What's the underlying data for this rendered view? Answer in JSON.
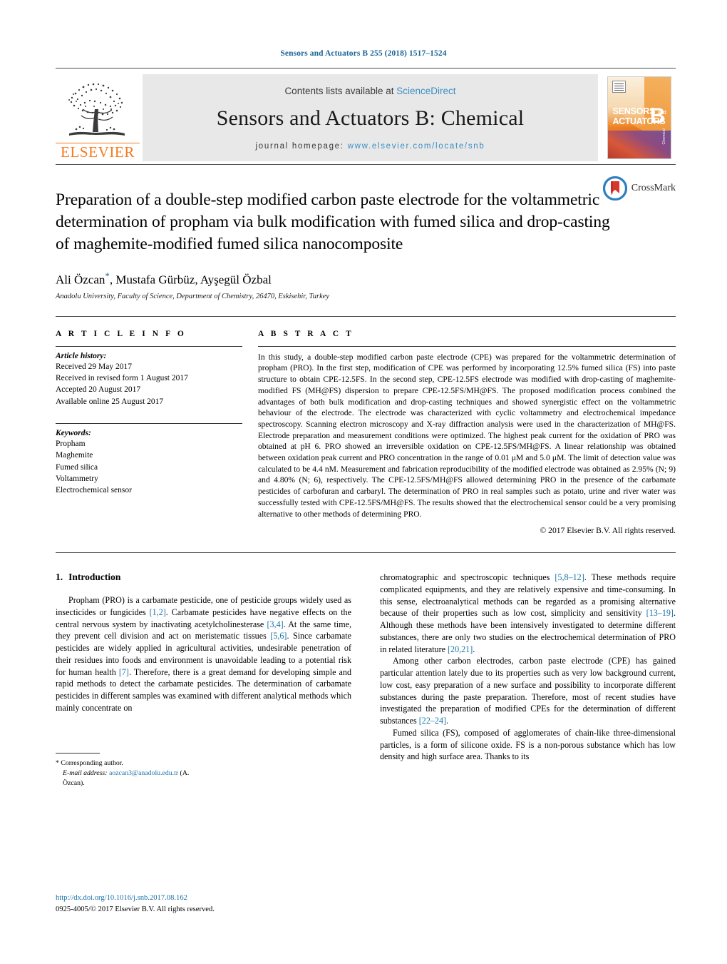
{
  "running_head": "Sensors and Actuators B 255 (2018) 1517–1524",
  "masthead": {
    "contents_prefix": "Contents lists available at ",
    "contents_link": "ScienceDirect",
    "journal_title": "Sensors and Actuators B: Chemical",
    "homepage_prefix": "journal homepage: ",
    "homepage_link": "www.elsevier.com/locate/snb",
    "publisher": "ELSEVIER",
    "cover": {
      "line1": "SENSORS",
      "line1_small": "and",
      "line2": "ACTUATORS",
      "letter": "B",
      "letter_sub": "Chemical"
    },
    "colors": {
      "link": "#3a8fc4",
      "elsevier_orange": "#f47b20",
      "panel_gray": "#e8e8e8"
    }
  },
  "article": {
    "title": "Preparation of a double-step modified carbon paste electrode for the voltammetric determination of propham via bulk modification with fumed silica and drop-casting of maghemite-modified fumed silica nanocomposite",
    "authors": "Ali Özcan",
    "authors_rest": ", Mustafa Gürbüz, Ayşegül Özbal",
    "corresponding_marker": "*",
    "affiliation": "Anadolu University, Faculty of Science, Department of Chemistry, 26470, Eskisehir, Turkey",
    "crossmark_label": "CrossMark"
  },
  "article_info": {
    "heading": "A R T I C L E   I N F O",
    "history_label": "Article history:",
    "history": [
      "Received 29 May 2017",
      "Received in revised form 1 August 2017",
      "Accepted 20 August 2017",
      "Available online 25 August 2017"
    ],
    "keywords_label": "Keywords:",
    "keywords": [
      "Propham",
      "Maghemite",
      "Fumed silica",
      "Voltammetry",
      "Electrochemical sensor"
    ]
  },
  "abstract": {
    "heading": "A B S T R A C T",
    "text": "In this study, a double-step modified carbon paste electrode (CPE) was prepared for the voltammetric determination of propham (PRO). In the first step, modification of CPE was performed by incorporating 12.5% fumed silica (FS) into paste structure to obtain CPE-12.5FS. In the second step, CPE-12.5FS electrode was modified with drop-casting of maghemite-modified FS (MH@FS) dispersion to prepare CPE-12.5FS/MH@FS. The proposed modification process combined the advantages of both bulk modification and drop-casting techniques and showed synergistic effect on the voltammetric behaviour of the electrode. The electrode was characterized with cyclic voltammetry and electrochemical impedance spectroscopy. Scanning electron microscopy and X-ray diffraction analysis were used in the characterization of MH@FS. Electrode preparation and measurement conditions were optimized. The highest peak current for the oxidation of PRO was obtained at pH 6. PRO showed an irreversible oxidation on CPE-12.5FS/MH@FS. A linear relationship was obtained between oxidation peak current and PRO concentration in the range of 0.01 μM and 5.0 μM. The limit of detection value was calculated to be 4.4 nM. Measurement and fabrication reproducibility of the modified electrode was obtained as 2.95% (N; 9) and 4.80% (N; 6), respectively. The CPE-12.5FS/MH@FS allowed determining PRO in the presence of the carbamate pesticides of carbofuran and carbaryl. The determination of PRO in real samples such as potato, urine and river water was successfully tested with CPE-12.5FS/MH@FS. The results showed that the electrochemical sensor could be a very promising alternative to other methods of determining PRO.",
    "copyright": "© 2017 Elsevier B.V. All rights reserved."
  },
  "introduction": {
    "number": "1.",
    "heading": "Introduction",
    "left_paragraph_part1": "Propham (PRO) is a carbamate pesticide, one of pesticide groups widely used as insecticides or fungicides ",
    "ref_1_2": "[1,2]",
    "left_paragraph_part2": ". Carbamate pesticides have negative effects on the central nervous system by inactivating acetylcholinesterase ",
    "ref_3_4": "[3,4]",
    "left_paragraph_part3": ". At the same time, they prevent cell division and act on meristematic tissues ",
    "ref_5_6": "[5,6]",
    "left_paragraph_part4": ". Since carbamate pesticides are widely applied in agricultural activities, undesirable penetration of their residues into foods and environment is unavoidable leading to a potential risk for human health ",
    "ref_7": "[7]",
    "left_paragraph_part5": ". Therefore, there is a great demand for developing simple and rapid methods to detect the carbamate pesticides. The determination of carbamate pesticides in different samples was examined with different analytical methods which mainly concentrate on",
    "right_p1_part1": "chromatographic and spectroscopic techniques ",
    "ref_5_8_12": "[5,8–12]",
    "right_p1_part2": ". These methods require complicated equipments, and they are relatively expensive and time-consuming. In this sense, electroanalytical methods can be regarded as a promising alternative because of their properties such as low cost, simplicity and sensitivity ",
    "ref_13_19": "[13–19]",
    "right_p1_part3": ". Although these methods have been intensively investigated to determine different substances, there are only two studies on the electrochemical determination of PRO in related literature ",
    "ref_20_21": "[20,21]",
    "right_p1_part4": ".",
    "right_p2": "Among other carbon electrodes, carbon paste electrode (CPE) has gained particular attention lately due to its properties such as very low background current, low cost, easy preparation of a new surface and possibility to incorporate different substances during the paste preparation. Therefore, most of recent studies have investigated the preparation of modified CPEs for the determination of different substances ",
    "ref_22_24": "[22–24]",
    "right_p2_end": ".",
    "right_p3": "Fumed silica (FS), composed of agglomerates of chain-like three-dimensional particles, is a form of silicone oxide. FS is a non-porous substance which has low density and high surface area. Thanks to its"
  },
  "footnote": {
    "corresponding": "* Corresponding author.",
    "email_label": "E-mail address:",
    "email": "aozcan3@anadolu.edu.tr",
    "email_suffix": " (A. Özcan)."
  },
  "page_footer": {
    "doi": "http://dx.doi.org/10.1016/j.snb.2017.08.162",
    "issn_copyright": "0925-4005/© 2017 Elsevier B.V. All rights reserved."
  }
}
